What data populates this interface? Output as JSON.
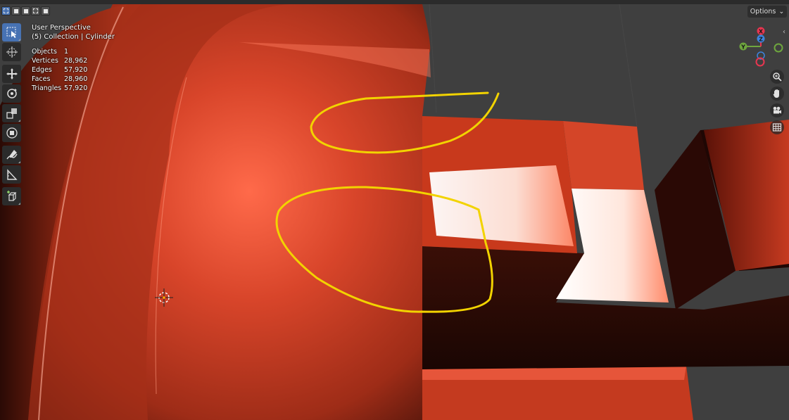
{
  "viewport": {
    "view_name": "User Perspective",
    "collection_line": "(5) Collection | Cylinder",
    "stats": [
      {
        "label": "Objects",
        "value": "1"
      },
      {
        "label": "Vertices",
        "value": "28,962"
      },
      {
        "label": "Edges",
        "value": "57,920"
      },
      {
        "label": "Faces",
        "value": "28,960"
      },
      {
        "label": "Triangles",
        "value": "57,920"
      }
    ]
  },
  "header": {
    "options_label": "Options",
    "options_chevron": "⌄"
  },
  "gizmo": {
    "x_label": "X",
    "y_label": "Y",
    "z_label": "Z"
  },
  "toolbar": {
    "tools": [
      "select-box",
      "cursor",
      "move",
      "rotate",
      "scale",
      "transform",
      "annotate",
      "measure",
      "add-cube"
    ]
  },
  "navigation": [
    "zoom-icon",
    "hand-icon",
    "camera-icon",
    "grid-icon"
  ],
  "colors": {
    "object": "#c8391c",
    "highlight": "#ff6a4a",
    "annotation": "#f2d300",
    "background": "#3d3d3d",
    "active_tool": "#4772b3",
    "axis_x": "#e83650",
    "axis_y": "#6ea63e",
    "axis_z": "#3d85e0"
  }
}
